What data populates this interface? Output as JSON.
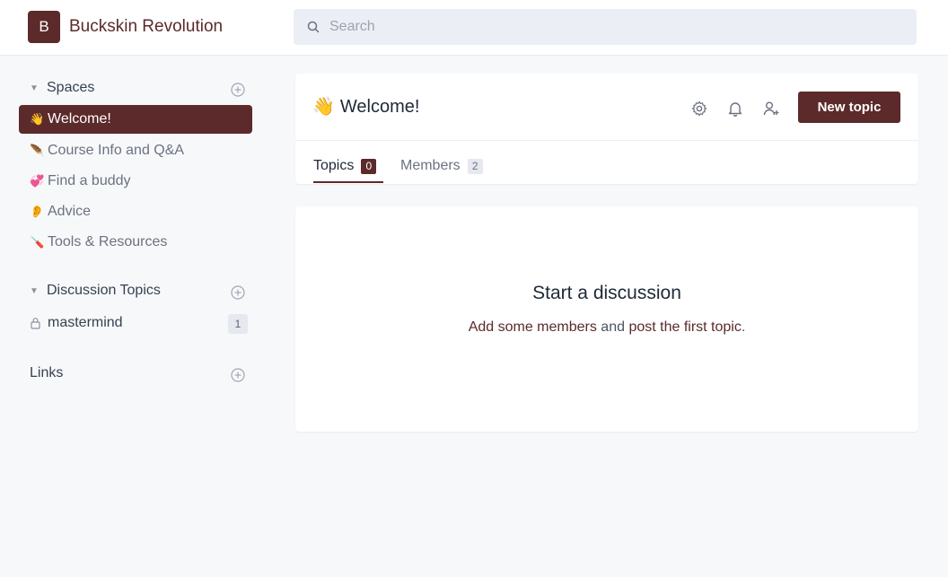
{
  "header": {
    "logo_letter": "B",
    "app_name": "Buckskin Revolution",
    "search_placeholder": "Search"
  },
  "sidebar": {
    "spaces_label": "Spaces",
    "spaces": [
      {
        "emoji": "👋",
        "label": "Welcome!",
        "active": true
      },
      {
        "emoji": "🪶",
        "label": "Course Info and Q&A"
      },
      {
        "emoji": "💞",
        "label": "Find a buddy"
      },
      {
        "emoji": "👂",
        "label": "Advice"
      },
      {
        "emoji": "🪛",
        "label": "Tools & Resources"
      }
    ],
    "discussion_label": "Discussion Topics",
    "discussion_items": [
      {
        "icon": "lock-icon",
        "label": "mastermind",
        "count": "1"
      }
    ],
    "links_label": "Links"
  },
  "main": {
    "emoji": "👋",
    "title": "Welcome!",
    "new_topic_label": "New topic",
    "tabs": [
      {
        "label": "Topics",
        "count": "0"
      },
      {
        "label": "Members",
        "count": "2"
      }
    ],
    "empty_title": "Start a discussion",
    "empty_link1": "Add some members",
    "empty_and": " and ",
    "empty_link2": "post the first topic",
    "empty_period": "."
  },
  "colors": {
    "brand": "#5c2a2a",
    "background": "#f7f8fa",
    "muted": "#6b7280"
  }
}
